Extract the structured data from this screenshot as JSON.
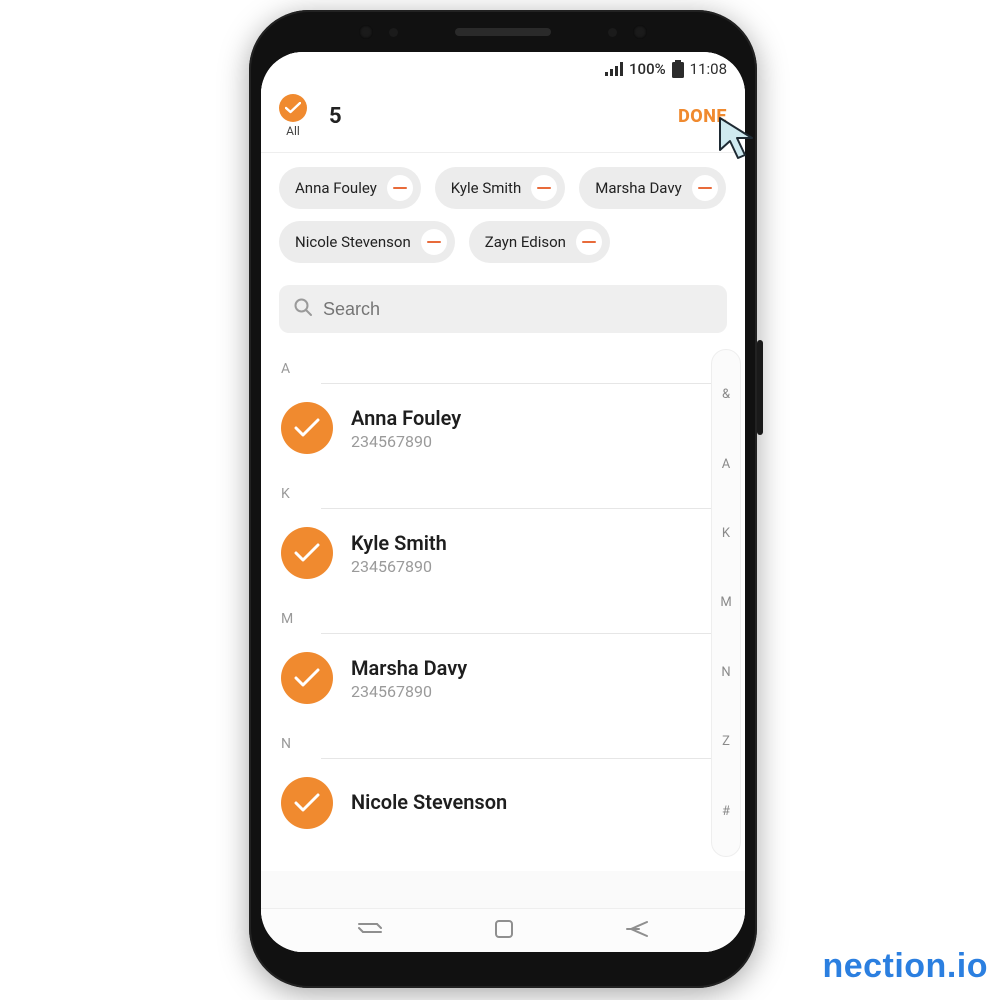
{
  "status": {
    "battery_pct": "100%",
    "time": "11:08"
  },
  "header": {
    "all_label": "All",
    "selected_count": "5",
    "done_label": "DONE"
  },
  "chips": [
    "Anna Fouley",
    "Kyle Smith",
    "Marsha Davy",
    "Nicole Stevenson",
    "Zayn Edison"
  ],
  "search": {
    "placeholder": "Search"
  },
  "sections": [
    {
      "letter": "A",
      "contacts": [
        {
          "name": "Anna Fouley",
          "number": "234567890"
        }
      ]
    },
    {
      "letter": "K",
      "contacts": [
        {
          "name": "Kyle Smith",
          "number": "234567890"
        }
      ]
    },
    {
      "letter": "M",
      "contacts": [
        {
          "name": "Marsha Davy",
          "number": "234567890"
        }
      ]
    },
    {
      "letter": "N",
      "contacts": [
        {
          "name": "Nicole Stevenson",
          "number": ""
        }
      ]
    }
  ],
  "alpha_index": [
    "&",
    "A",
    "K",
    "M",
    "N",
    "Z",
    "#"
  ],
  "watermark": "nection.io"
}
